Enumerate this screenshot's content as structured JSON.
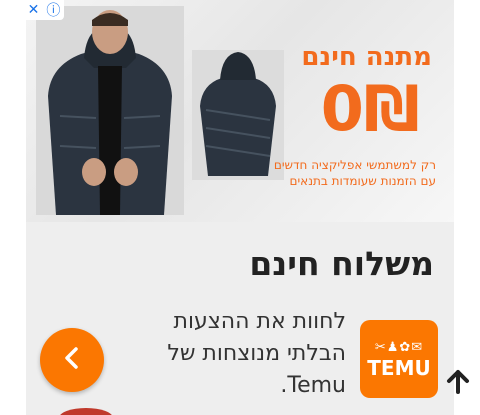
{
  "ad": {
    "adchoices": {
      "info_icon": "ⓘ",
      "close_icon": "✕"
    },
    "promo": {
      "title": "מתנה חינם",
      "amount": "0₪",
      "line1": "רק למשתמשי אפליקציה חדשים",
      "line2": "עם הזמנות שעומדות בתנאים"
    },
    "headline": "משלוח חינם",
    "description": "לחוות את ההצעות הבלתי מנוצחות של Temu.",
    "logo_text": "TEMU",
    "logo_icons": "✂︎♟✿✉"
  },
  "colors": {
    "brand": "#fb7701",
    "promo": "#f26b1d",
    "jacket": "#2b3440"
  },
  "icons": {
    "back": "chevron-left-icon",
    "scroll_top": "arrow-up-icon"
  }
}
